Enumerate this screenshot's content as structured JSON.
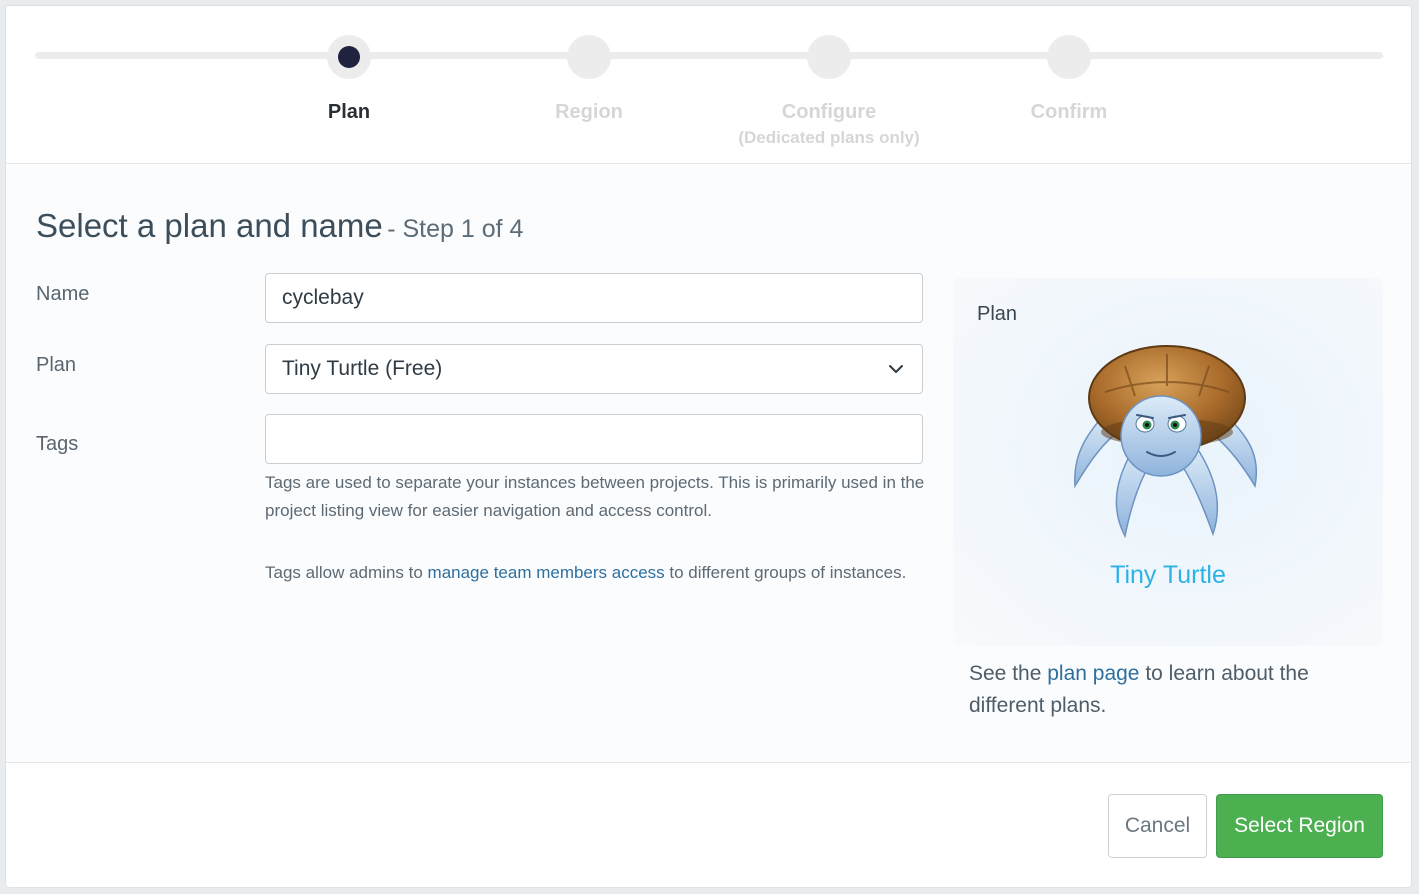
{
  "stepper": {
    "steps": [
      {
        "label": "Plan",
        "sublabel": "",
        "state": "active"
      },
      {
        "label": "Region",
        "sublabel": "",
        "state": "pending"
      },
      {
        "label": "Configure",
        "sublabel": "(Dedicated plans only)",
        "state": "pending"
      },
      {
        "label": "Confirm",
        "sublabel": "",
        "state": "pending"
      }
    ]
  },
  "form": {
    "title": "Select a plan and name",
    "step_text": "- Step 1 of 4",
    "name_label": "Name",
    "name_value": "cyclebay",
    "plan_label": "Plan",
    "plan_value": "Tiny Turtle (Free)",
    "tags_label": "Tags",
    "tags_value": "",
    "tags_help_1": "Tags are used to separate your instances between projects. This is primarily used in the project listing view for easier navigation and access control.",
    "tags_help_2_pre": "Tags allow admins to ",
    "tags_help_2_link": "manage team members access",
    "tags_help_2_post": " to different groups of instances."
  },
  "plan_panel": {
    "heading": "Plan",
    "plan_name": "Tiny Turtle",
    "note_pre": "See the ",
    "note_link": "plan page",
    "note_post": " to learn about the different plans."
  },
  "footer": {
    "cancel_label": "Cancel",
    "primary_label": "Select Region"
  },
  "colors": {
    "active_step": "#1f2340",
    "link": "#2e6f9e",
    "plan_name": "#2bb3e6",
    "primary_button": "#4caf50"
  },
  "icons": {
    "select_chevron": "chevron-down-icon",
    "plan_image": "turtle-illustration"
  }
}
